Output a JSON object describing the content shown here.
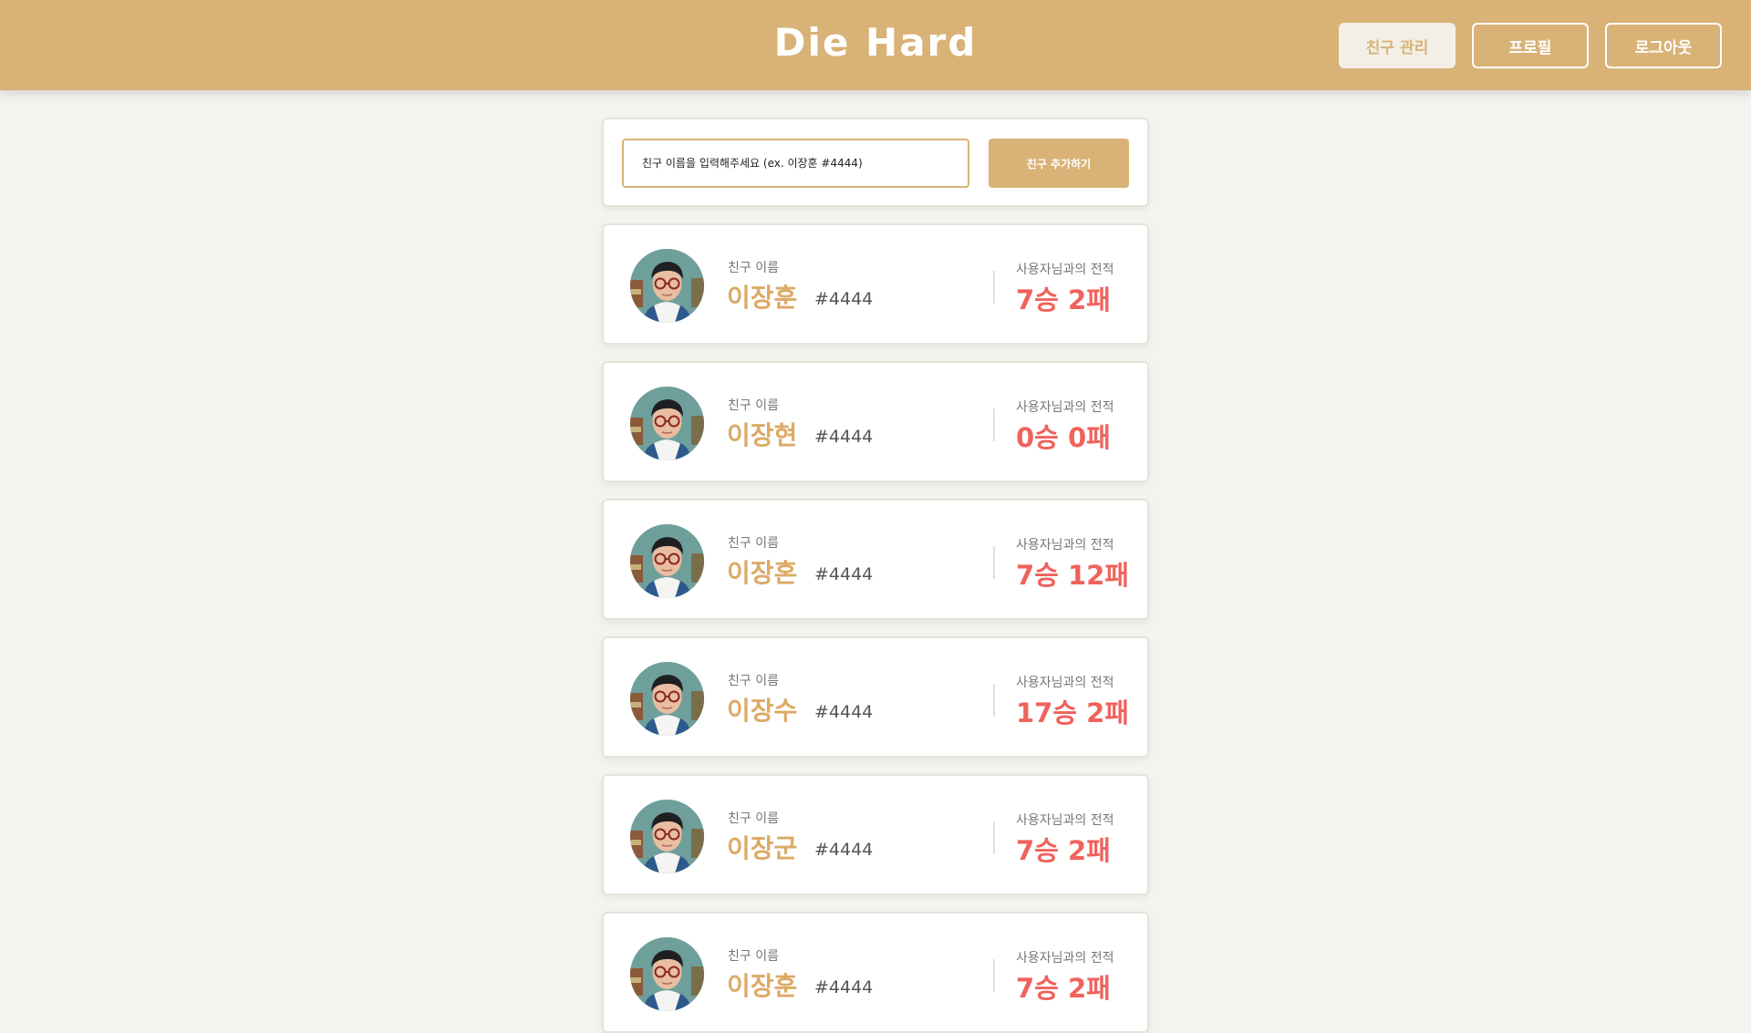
{
  "header": {
    "logo": "Die Hard",
    "nav": [
      {
        "label": "친구 관리",
        "active": true
      },
      {
        "label": "프로필",
        "active": false
      },
      {
        "label": "로그아웃",
        "active": false
      }
    ]
  },
  "add_friend": {
    "placeholder": "친구 이름을 입력해주세요 (ex. 이장훈 #4444)",
    "button_label": "친구 추가하기"
  },
  "friend_card_labels": {
    "name_label": "친구 이름",
    "record_label": "사용자님과의 전적"
  },
  "friends": [
    {
      "name": "이장훈",
      "tag": "#4444",
      "record": "7승 2패"
    },
    {
      "name": "이장현",
      "tag": "#4444",
      "record": "0승 0패"
    },
    {
      "name": "이장혼",
      "tag": "#4444",
      "record": "7승 12패"
    },
    {
      "name": "이장수",
      "tag": "#4444",
      "record": "17승 2패"
    },
    {
      "name": "이장군",
      "tag": "#4444",
      "record": "7승 2패"
    },
    {
      "name": "이장훈",
      "tag": "#4444",
      "record": "7승 2패"
    }
  ],
  "colors": {
    "header_bg": "#d9b277",
    "page_bg": "#f4f3ef",
    "accent_name": "#dcaa66",
    "record_red": "#f0625c"
  }
}
